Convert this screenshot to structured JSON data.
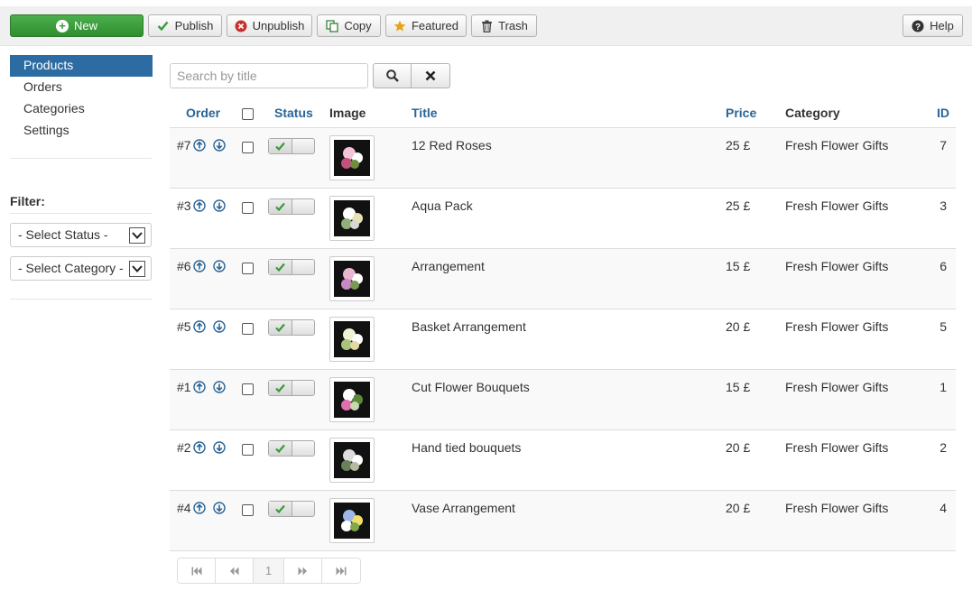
{
  "toolbar": {
    "new": "New",
    "publish": "Publish",
    "unpublish": "Unpublish",
    "copy": "Copy",
    "featured": "Featured",
    "trash": "Trash",
    "help": "Help"
  },
  "sidebar": {
    "items": [
      {
        "label": "Products",
        "active": true
      },
      {
        "label": "Orders"
      },
      {
        "label": "Categories"
      },
      {
        "label": "Settings"
      }
    ],
    "filter_label": "Filter:",
    "status_select": "- Select Status -",
    "category_select": "- Select Category -"
  },
  "search": {
    "placeholder": "Search by title"
  },
  "table": {
    "headers": {
      "order": "Order",
      "status": "Status",
      "image": "Image",
      "title": "Title",
      "price": "Price",
      "category": "Category",
      "id": "ID"
    },
    "rows": [
      {
        "order": "#7",
        "title": "12 Red Roses",
        "price": "25 £",
        "category": "Fresh Flower Gifts",
        "id": "7"
      },
      {
        "order": "#3",
        "title": "Aqua Pack",
        "price": "25 £",
        "category": "Fresh Flower Gifts",
        "id": "3"
      },
      {
        "order": "#6",
        "title": "Arrangement",
        "price": "15 £",
        "category": "Fresh Flower Gifts",
        "id": "6"
      },
      {
        "order": "#5",
        "title": "Basket Arrangement",
        "price": "20 £",
        "category": "Fresh Flower Gifts",
        "id": "5"
      },
      {
        "order": "#1",
        "title": "Cut Flower Bouquets",
        "price": "15 £",
        "category": "Fresh Flower Gifts",
        "id": "1"
      },
      {
        "order": "#2",
        "title": "Hand tied bouquets",
        "price": "20 £",
        "category": "Fresh Flower Gifts",
        "id": "2"
      },
      {
        "order": "#4",
        "title": "Vase Arrangement",
        "price": "20 £",
        "category": "Fresh Flower Gifts",
        "id": "4"
      }
    ]
  },
  "pagination": {
    "current_page": "1"
  },
  "colors": {
    "accent": "#2d6ca2",
    "link": "#2a6496",
    "new_button": "#3a9a3a"
  }
}
